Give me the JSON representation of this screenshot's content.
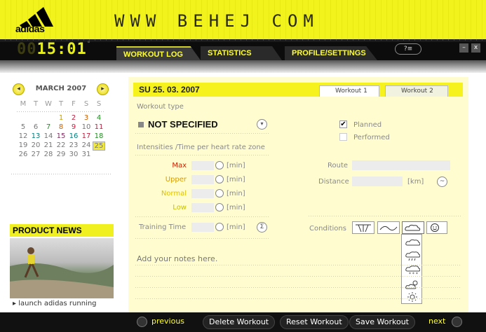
{
  "header": {
    "brand": "adidas",
    "site": "WWW BEHEJ COM",
    "clock_dim": "00",
    "clock_lit": "15:01",
    "clock_suffix": "°"
  },
  "tabs": [
    {
      "label": "WORKOUT LOG",
      "active": true
    },
    {
      "label": "STATISTICS",
      "active": false
    },
    {
      "label": "PROFILE/SETTINGS",
      "active": false
    }
  ],
  "window": {
    "help": "?≡",
    "minimize": "–",
    "close": "x"
  },
  "calendar": {
    "month": "MARCH 2007",
    "dow": [
      "M",
      "T",
      "W",
      "T",
      "F",
      "S",
      "S"
    ],
    "weeks": [
      [
        "",
        "",
        "",
        "1",
        "2",
        "3",
        "4"
      ],
      [
        "5",
        "6",
        "7",
        "8",
        "9",
        "10",
        "11"
      ],
      [
        "12",
        "13",
        "14",
        "15",
        "16",
        "17",
        "18"
      ],
      [
        "19",
        "20",
        "21",
        "22",
        "23",
        "24",
        "25"
      ],
      [
        "26",
        "27",
        "28",
        "29",
        "30",
        "31",
        ""
      ]
    ],
    "today": "25"
  },
  "news": {
    "title": "PRODUCT NEWS",
    "link": "launch adidas running"
  },
  "workout": {
    "date": "SU 25. 03. 2007",
    "tabs": [
      "Workout 1",
      "Workout 2"
    ],
    "type_label": "Workout type",
    "type_value": "NOT SPECIFIED",
    "planned": "Planned",
    "performed": "Performed",
    "zones_label": "Intensities /Time per heart rate zone",
    "zones": [
      {
        "name": "Max",
        "color": "#cc2200"
      },
      {
        "name": "Upper",
        "color": "#d89a00"
      },
      {
        "name": "Normal",
        "color": "#e0c000"
      },
      {
        "name": "Low",
        "color": "#c8c000"
      }
    ],
    "unit_min": "[min]",
    "training_time": "Training Time",
    "route": "Route",
    "distance": "Distance",
    "unit_km": "[km]",
    "conditions": "Conditions",
    "notes_placeholder": "Add your notes here."
  },
  "footer": {
    "previous": "previous",
    "delete": "Delete Workout",
    "reset": "Reset Workout",
    "save": "Save Workout",
    "next": "next"
  }
}
